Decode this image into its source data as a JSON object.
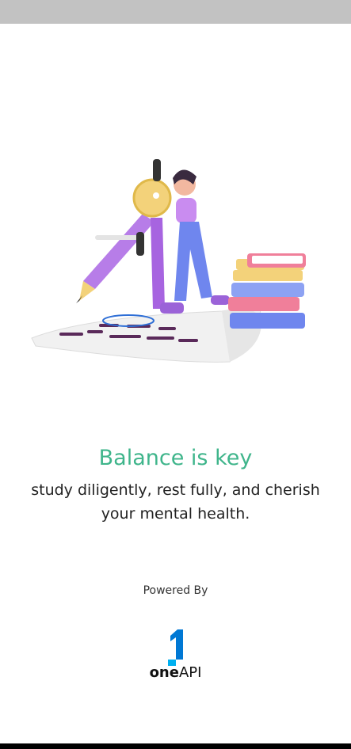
{
  "splash": {
    "headline": "Balance is key",
    "subtitle": "study diligently, rest fully, and cherish your mental health.",
    "powered_by": "Powered By",
    "brand": {
      "name_part1": "one",
      "name_part2": "API",
      "mark": "1"
    }
  },
  "colors": {
    "headline": "#3fb58b",
    "status_bar": "#c2c2c2",
    "brand_blue": "#0078d4"
  }
}
